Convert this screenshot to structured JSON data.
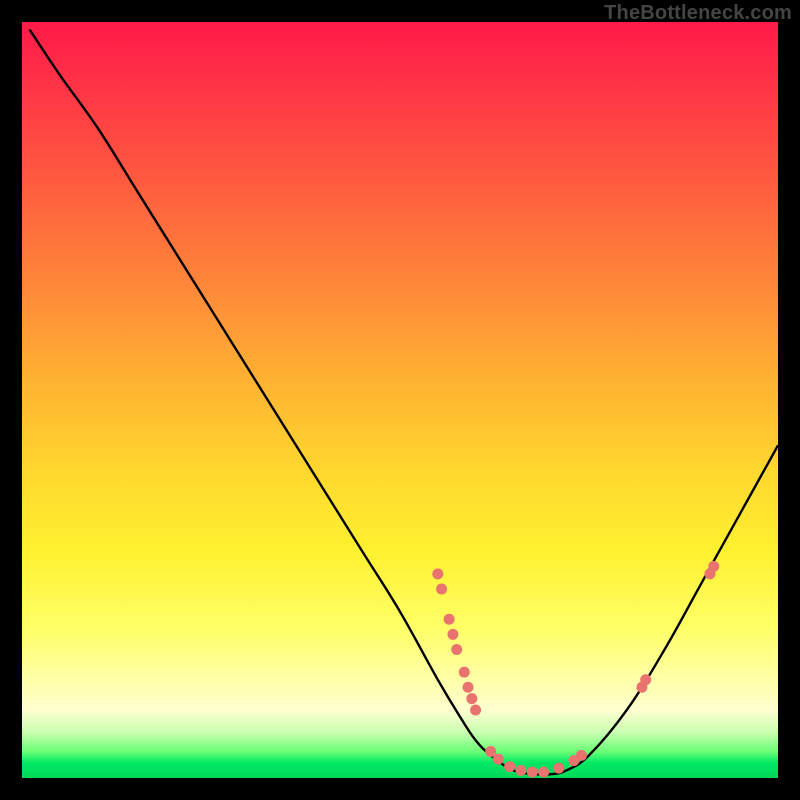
{
  "watermark": "TheBottleneck.com",
  "chart_data": {
    "type": "line",
    "title": "",
    "xlabel": "",
    "ylabel": "",
    "xlim": [
      0,
      100
    ],
    "ylim": [
      0,
      100
    ],
    "grid": false,
    "legend": false,
    "series": [
      {
        "name": "bottleneck-curve",
        "x": [
          1,
          5,
          10,
          15,
          20,
          25,
          30,
          35,
          40,
          45,
          50,
          55,
          58,
          60,
          62,
          65,
          68,
          70,
          72,
          75,
          80,
          85,
          90,
          95,
          100
        ],
        "values": [
          99,
          93,
          86,
          78,
          70,
          62,
          54,
          46,
          38,
          30,
          22,
          13,
          8,
          5,
          3,
          1,
          0.5,
          0.5,
          1,
          3,
          9,
          17,
          26,
          35,
          44
        ]
      }
    ],
    "highlight_points": [
      {
        "x": 55,
        "y": 27
      },
      {
        "x": 55.5,
        "y": 25
      },
      {
        "x": 56.5,
        "y": 21
      },
      {
        "x": 57,
        "y": 19
      },
      {
        "x": 57.5,
        "y": 17
      },
      {
        "x": 58.5,
        "y": 14
      },
      {
        "x": 59,
        "y": 12
      },
      {
        "x": 59.5,
        "y": 10.5
      },
      {
        "x": 60,
        "y": 9
      },
      {
        "x": 62,
        "y": 3.5
      },
      {
        "x": 63,
        "y": 2.5
      },
      {
        "x": 64.5,
        "y": 1.5
      },
      {
        "x": 66,
        "y": 1
      },
      {
        "x": 67.5,
        "y": 0.8
      },
      {
        "x": 69,
        "y": 0.8
      },
      {
        "x": 71,
        "y": 1.3
      },
      {
        "x": 73,
        "y": 2.3
      },
      {
        "x": 74,
        "y": 3
      },
      {
        "x": 82,
        "y": 12
      },
      {
        "x": 82.5,
        "y": 13
      },
      {
        "x": 91,
        "y": 27
      },
      {
        "x": 91.5,
        "y": 28
      }
    ],
    "colors": {
      "curve": "#000000",
      "points": "#e9736f"
    }
  }
}
